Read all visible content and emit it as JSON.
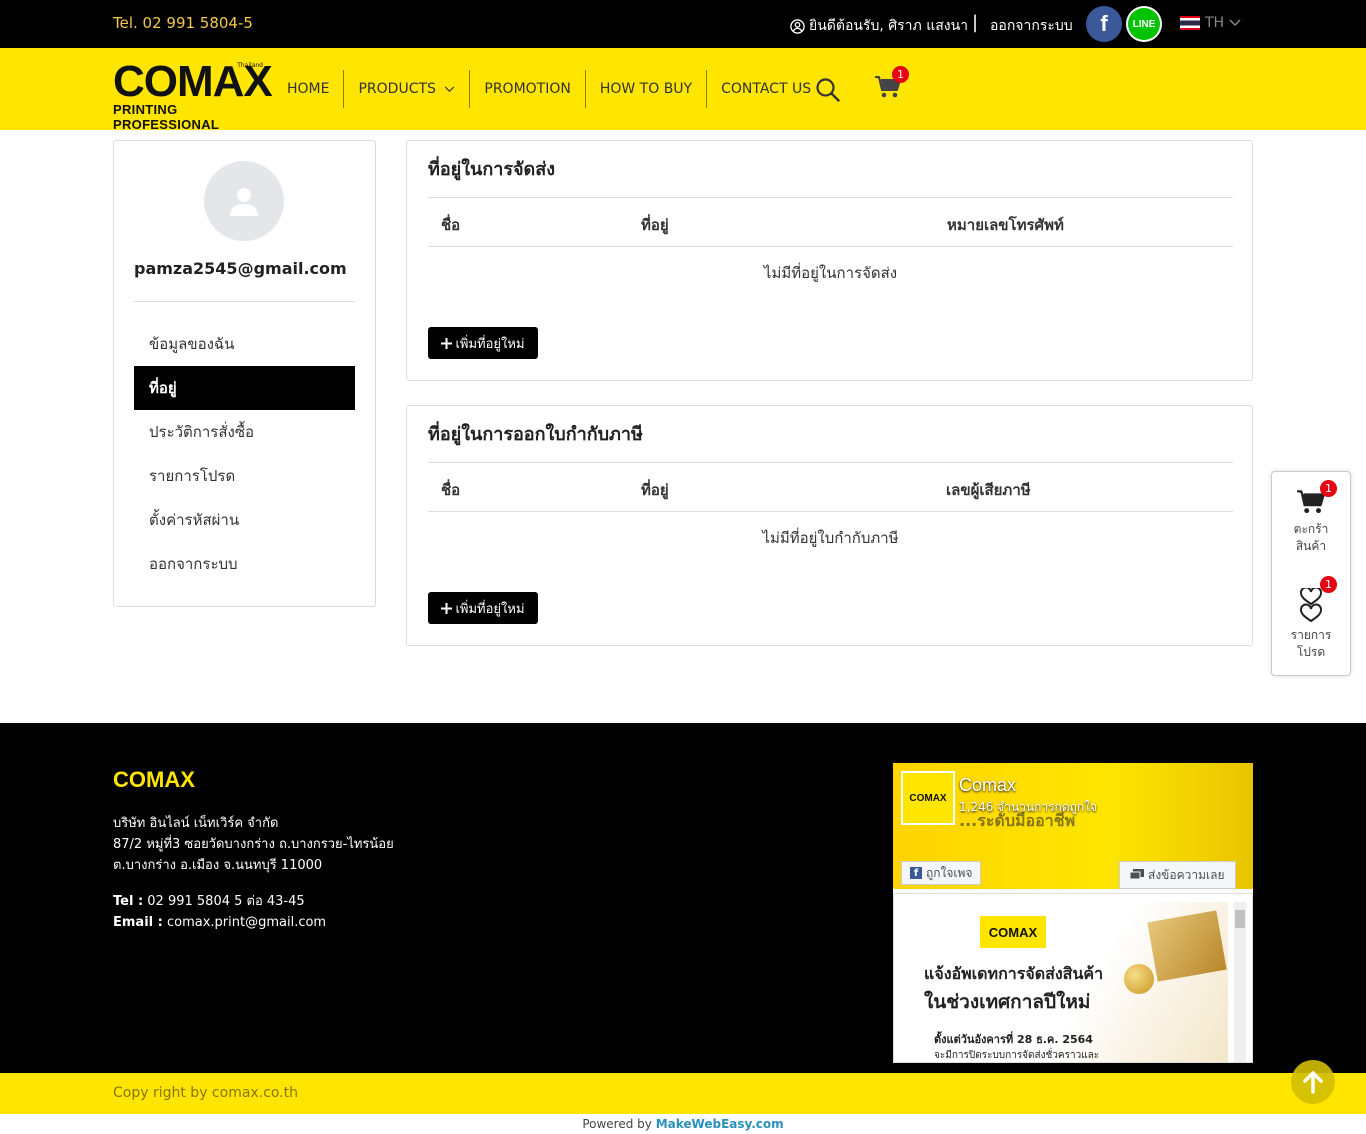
{
  "topbar": {
    "tel": "Tel. 02 991 5804-5",
    "welcome": "ยินดีต้อนรับ, ศิราภ แสงนา",
    "separator": "|",
    "logout": "ออกจากระบบ",
    "facebook_icon_letter": "f",
    "line_label": "LINE",
    "language": "TH",
    "icons": [
      "user-circle-icon",
      "facebook-icon",
      "line-icon",
      "thai-flag-icon",
      "chevron-down-icon"
    ]
  },
  "brand": {
    "logo_text": "COMAX",
    "logo_sub": "PRINTING PROFESSIONAL",
    "logo_tm": "Thailand",
    "accent_color": "#ffe500"
  },
  "nav": {
    "items": [
      {
        "label": "HOME"
      },
      {
        "label": "PRODUCTS"
      },
      {
        "label": "PROMOTION"
      },
      {
        "label": "HOW TO BUY"
      },
      {
        "label": "CONTACT US"
      }
    ],
    "cart_count": "1"
  },
  "sidebar": {
    "email": "pamza2545@gmail.com",
    "items": [
      {
        "label": "ข้อมูลของฉัน",
        "active": false
      },
      {
        "label": "ที่อยู่",
        "active": true
      },
      {
        "label": "ประวัติการสั่งซื้อ",
        "active": false
      },
      {
        "label": "รายการโปรด",
        "active": false
      },
      {
        "label": "ตั้งค่ารหัสผ่าน",
        "active": false
      },
      {
        "label": "ออกจากระบบ",
        "active": false
      }
    ]
  },
  "shipping": {
    "title": "ที่อยู่ในการจัดส่ง",
    "columns": [
      "ชื่อ",
      "ที่อยู่",
      "หมายเลขโทรศัพท์"
    ],
    "empty": "ไม่มีที่อยู่ในการจัดส่ง",
    "add_button": "เพิ่มที่อยู่ใหม่"
  },
  "tax": {
    "title": "ที่อยู่ในการออกใบกำกับภาษี",
    "columns": [
      "ชื่อ",
      "ที่อยู่",
      "เลขผู้เสียภาษี"
    ],
    "empty": "ไม่มีที่อยู่ใบกำกับภาษี",
    "add_button": "เพิ่มที่อยู่ใหม่"
  },
  "floating": {
    "cart_label_1": "ตะกร้า",
    "cart_label_2": "สินค้า",
    "cart_count": "1",
    "wish_label_1": "รายการ",
    "wish_label_2": "โปรด",
    "wish_count": "1"
  },
  "footer": {
    "brand": "COMAX",
    "company": "บริษัท อินไลน์ เน็ทเวิร์ค จำกัด",
    "address_1": "87/2 หมู่ที่3 ซอยวัดบางกร่าง ถ.บางกรวย-ไทรน้อย",
    "address_2": "ต.บางกร่าง อ.เมือง จ.นนทบุรี 11000",
    "tel_label": "Tel :",
    "tel_value": "02 991 5804 5 ต่อ 43-45",
    "email_label": "Email :",
    "email_value": "comax.print@gmail.com",
    "fb": {
      "page_name": "Comax",
      "likes": "1,246 จำนวนการกดถูกใจ",
      "cover_tagline": "...ระดับมืออาชีพ",
      "cover_logo": "COMAX",
      "like_button": "ถูกใจเพจ",
      "message_button": "ส่งข้อความเลย",
      "post_logo": "COMAX",
      "post_line_1": "แจ้งอัพเดทการจัดส่งสินค้า",
      "post_line_2": "ในช่วงเทศกาลปีใหม่",
      "post_line_3": "ตั้งแต่วันอังคารที่ 28 ธ.ค. 2564",
      "post_line_4": "จะมีการปิดระบบการจัดส่งชั่วคราวและ"
    }
  },
  "copyright": "Copy right by comax.co.th",
  "powered": {
    "prefix": "Powered by",
    "brand": "MakeWebEasy.com"
  }
}
